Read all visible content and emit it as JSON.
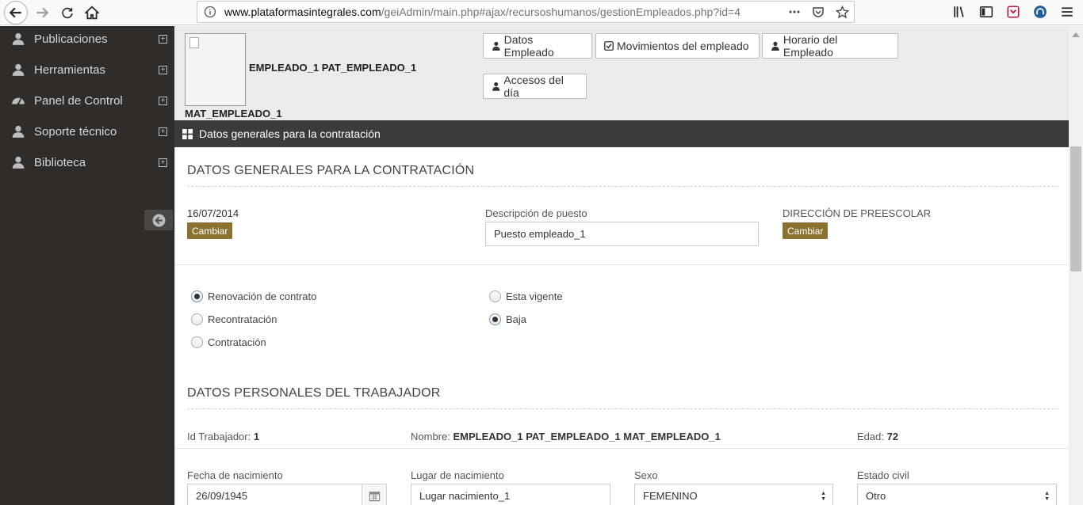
{
  "browser": {
    "url_host": "www.plataformasintegrales.com",
    "url_path": "/geiAdmin/main.php#ajax/recursoshumanos/gestionEmpleados.php?id=4"
  },
  "sidebar": {
    "items": [
      {
        "label": "Publicaciones",
        "icon": "user-icon"
      },
      {
        "label": "Herramientas",
        "icon": "user-icon"
      },
      {
        "label": "Panel de Control",
        "icon": "dashboard-icon"
      },
      {
        "label": "Soporte técnico",
        "icon": "user-icon"
      },
      {
        "label": "Biblioteca",
        "icon": "user-icon"
      }
    ],
    "expand_symbol": "+"
  },
  "employee": {
    "name": "EMPLEADO_1 PAT_EMPLEADO_1",
    "mat": "MAT_EMPLEADO_1"
  },
  "tabs": {
    "datos": "Datos Empleado",
    "movimientos": "Movimientos del empleado",
    "horario": "Horario del Empleado",
    "accesos": "Accesos del día"
  },
  "panel": {
    "title": "Datos generales para la contratación"
  },
  "contratacion": {
    "section_title": "DATOS GENERALES PARA LA CONTRATACIÓN",
    "fecha": "16/07/2014",
    "cambiar": "Cambiar",
    "puesto_label": "Descripción de puesto",
    "puesto_value": "Puesto empleado_1",
    "direccion": "DIRECCIÓN DE PREESCOLAR"
  },
  "radios": {
    "renovacion": "Renovación de contrato",
    "recontratacion": "Recontratación",
    "contratacion": "Contratación",
    "vigente": "Esta vigente",
    "baja": "Baja"
  },
  "personales": {
    "section_title": "DATOS PERSONALES DEL TRABAJADOR",
    "id_label": "Id Trabajador:",
    "id_value": "1",
    "nombre_label": "Nombre:",
    "nombre_value": "EMPLEADO_1 PAT_EMPLEADO_1 MAT_EMPLEADO_1",
    "edad_label": "Edad:",
    "edad_value": "72",
    "fecha_nac_label": "Fecha de nacimiento",
    "fecha_nac_value": "26/09/1945",
    "lugar_label": "Lugar de nacimiento",
    "lugar_value": "Lugar nacimiento_1",
    "sexo_label": "Sexo",
    "sexo_value": "FEMENINO",
    "civil_label": "Estado civil",
    "civil_value": "Otro"
  }
}
